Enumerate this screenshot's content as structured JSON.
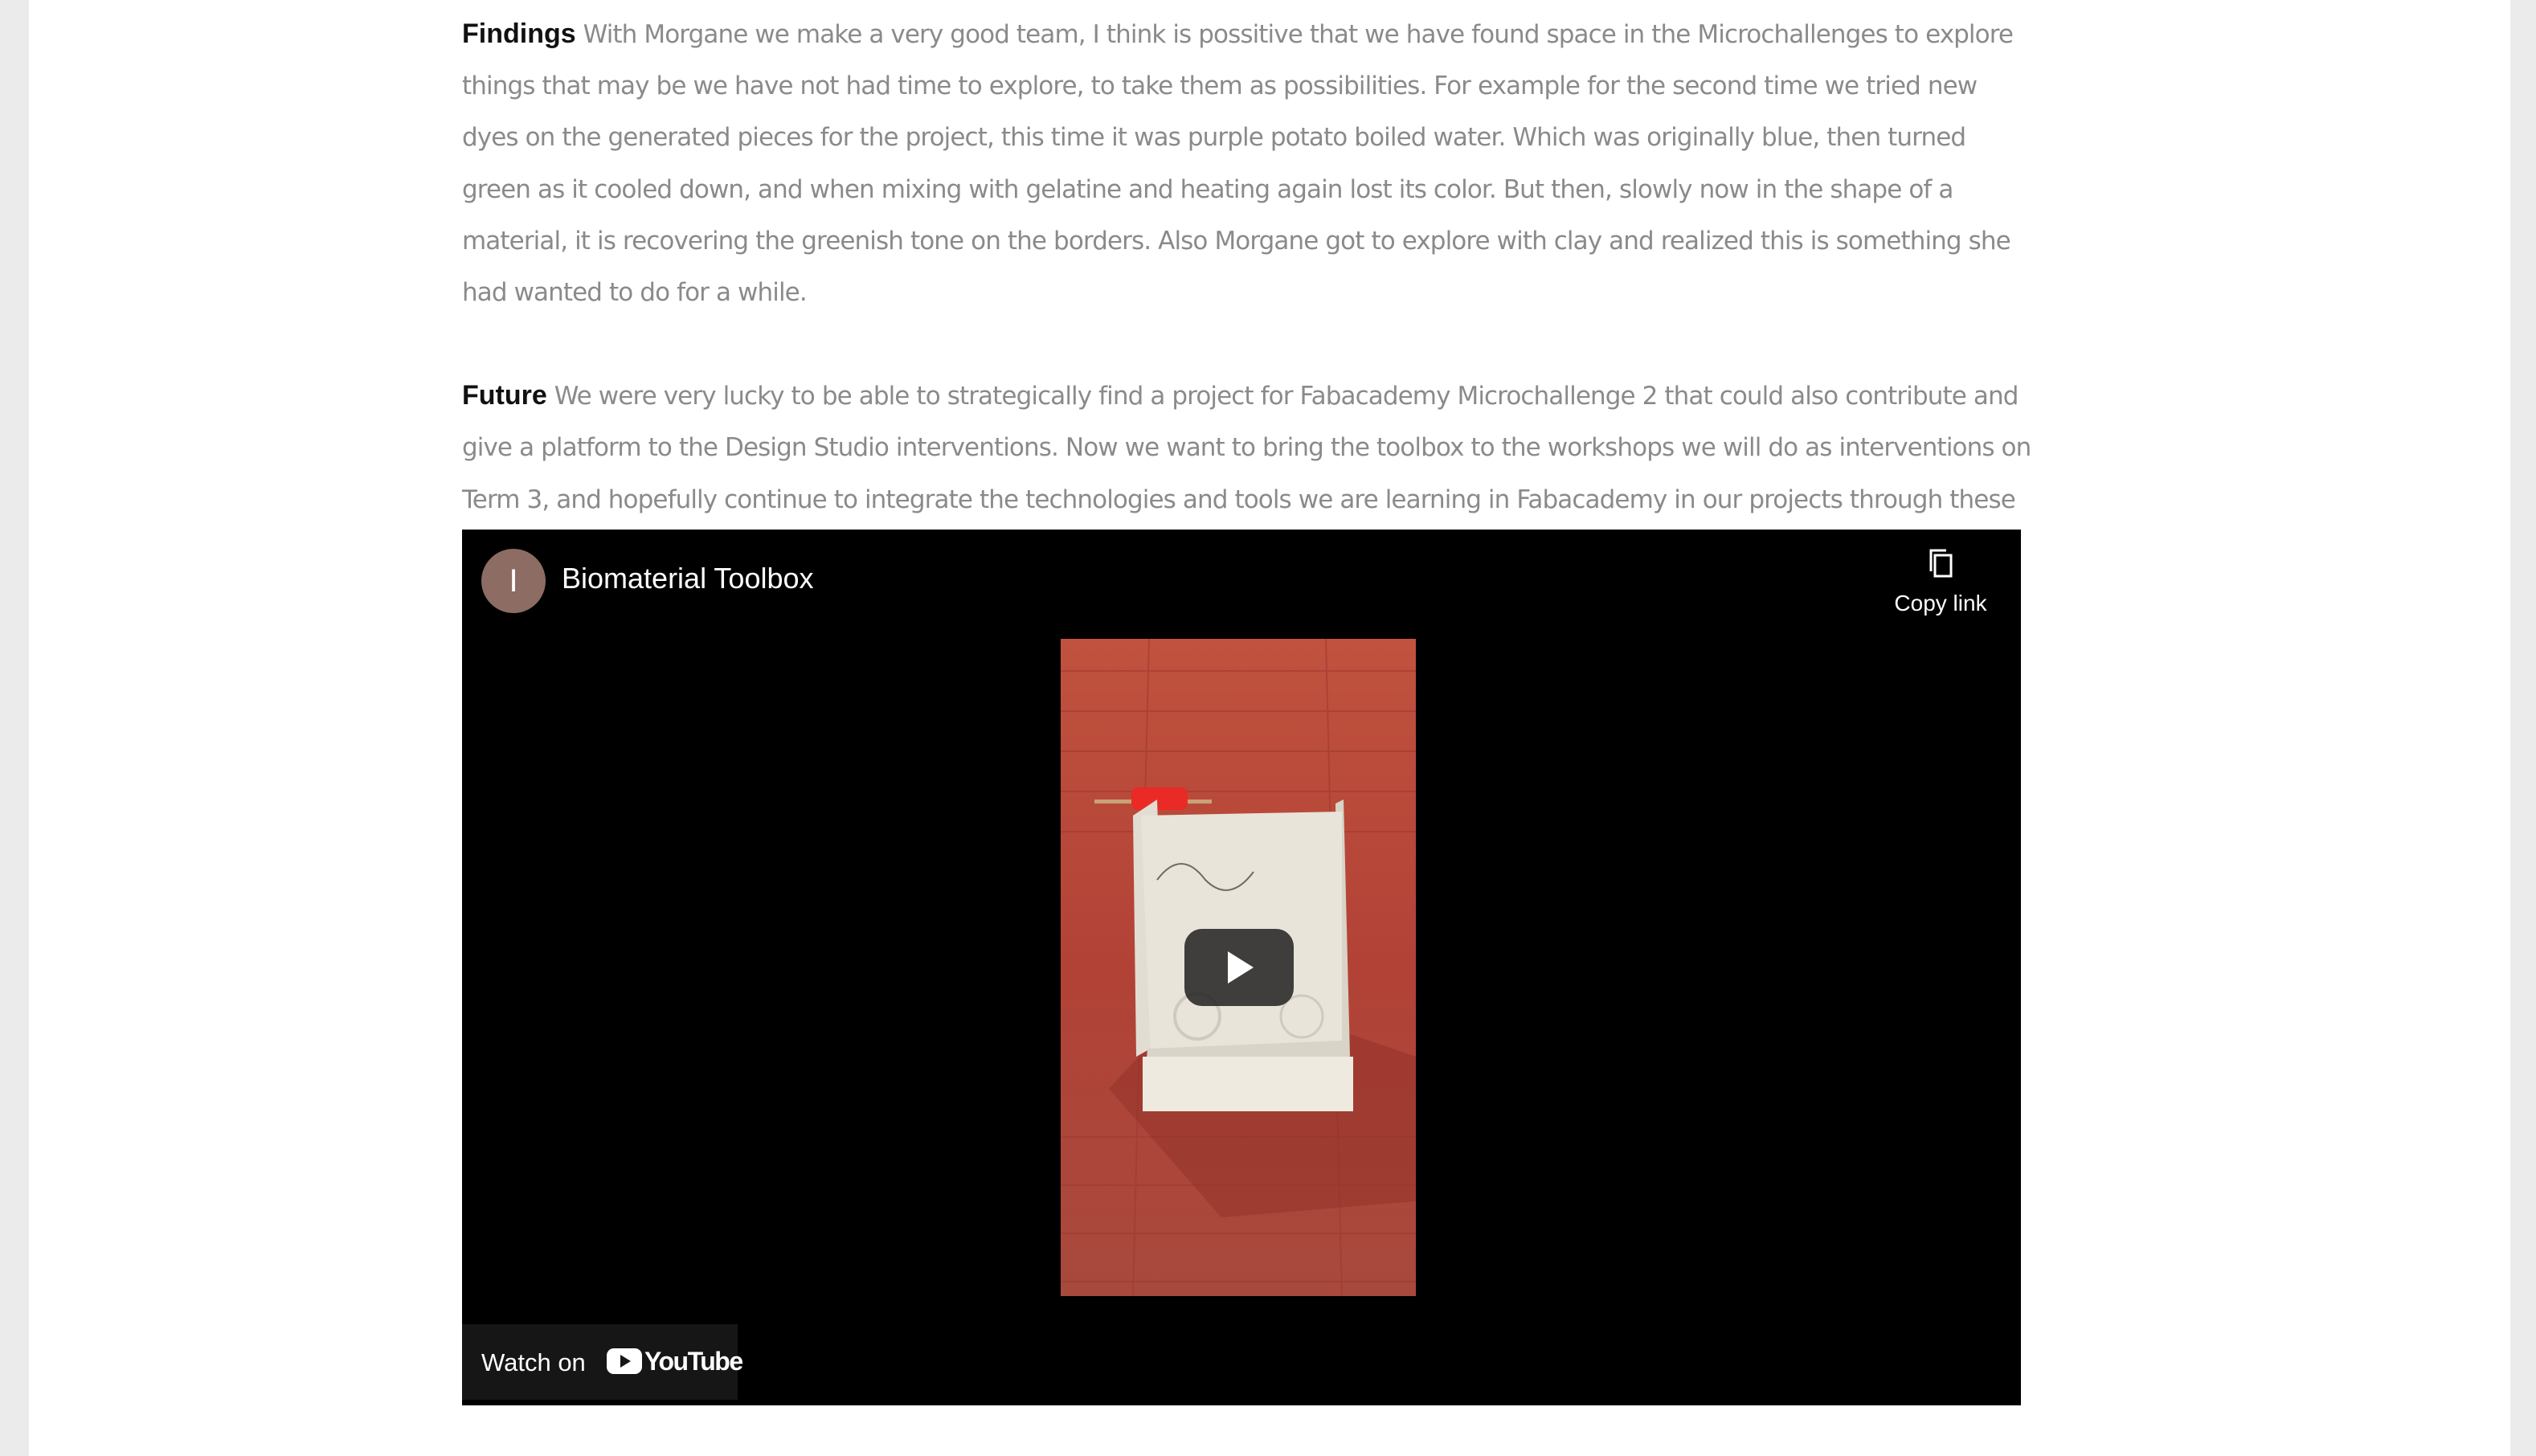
{
  "findings": {
    "heading": "Findings",
    "text": "With Morgane we make a very good team, I think is possitive that we have found space in the Microchallenges to explore things that may be we have not had time to explore, to take them as possibilities. For example for the second time we tried new dyes on the generated pieces for the project, this time it was purple potato boiled water. Which was originally blue, then turned green as it cooled down, and when mixing with gelatine and heating again lost its color. But then, slowly now in the shape of a material, it is recovering the greenish tone on the borders. Also Morgane got to explore with clay and realized this is something she had wanted to do for a while."
  },
  "future": {
    "heading": "Future",
    "text": "We were very lucky to be able to strategically find a project for Fabacademy Microchallenge 2 that could also contribute and give a platform to the Design Studio interventions. Now we want to bring the toolbox to the workshops we will do as interventions on Term 3, and hopefully continue to integrate the technologies and tools we are learning in Fabacademy in our projects through these artifacts."
  },
  "video": {
    "channel_initial": "I",
    "title": "Biomaterial Toolbox",
    "copy_link_label": "Copy link",
    "watch_on_label": "Watch on",
    "youtube_wordmark": "YouTube",
    "icons": {
      "copy": "copy-link-icon",
      "play": "play-icon",
      "youtube": "youtube-logo-icon"
    },
    "colors": {
      "avatar": "#8d6c64",
      "thumbnail_floor": "#b4483e",
      "youtube_red": "#ff0000"
    }
  }
}
